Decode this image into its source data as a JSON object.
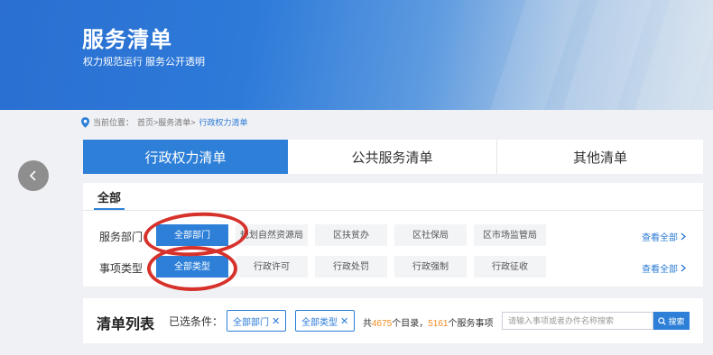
{
  "banner": {
    "title": "服务清单",
    "subtitle": "权力规范运行  服务公开透明"
  },
  "breadcrumb": {
    "prefix": "当前位置：",
    "path": "首页>服务清单>",
    "current": "行政权力清单"
  },
  "tabs": [
    {
      "label": "行政权力清单",
      "active": true
    },
    {
      "label": "公共服务清单",
      "active": false
    },
    {
      "label": "其他清单",
      "active": false
    }
  ],
  "filter": {
    "all_tab": "全部",
    "departments": {
      "label": "服务部门",
      "chips": [
        "全部部门",
        "规划自然资源局",
        "区扶贫办",
        "区社保局",
        "区市场监管局"
      ],
      "see_all": "查看全部"
    },
    "types": {
      "label": "事项类型",
      "chips": [
        "全部类型",
        "行政许可",
        "行政处罚",
        "行政强制",
        "行政征收"
      ],
      "see_all": "查看全部"
    }
  },
  "list": {
    "title": "清单列表",
    "selected_label": "已选条件：",
    "tags": [
      "全部部门",
      "全部类型"
    ],
    "summary_prefix": "共",
    "catalog_count": "4675",
    "catalog_text": "个目录，",
    "service_count": "5161",
    "service_text": "个服务事项",
    "search_placeholder": "请输入事项或者办件名称搜索",
    "search_button": "搜索"
  },
  "colors": {
    "accent": "#2d7fd8",
    "annotation": "#d6322b",
    "count": "#f08a1e"
  }
}
